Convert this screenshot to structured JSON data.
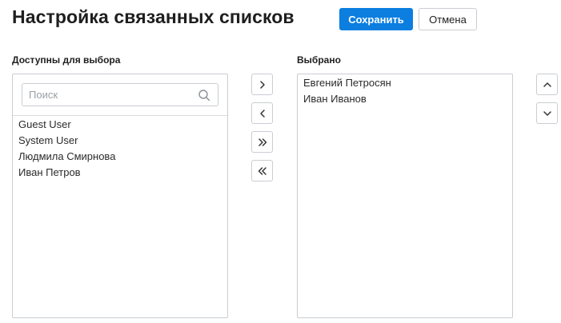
{
  "header": {
    "title": "Настройка связанных списков",
    "save_label": "Сохранить",
    "cancel_label": "Отмена"
  },
  "available": {
    "label": "Доступны для выбора",
    "search_placeholder": "Поиск",
    "search_value": "",
    "items": [
      "Guest User",
      "System User",
      "Людмила Смирнова",
      "Иван Петров"
    ]
  },
  "selected": {
    "label": "Выбрано",
    "items": [
      "Евгений Петросян",
      "Иван Иванов"
    ]
  },
  "transfer_buttons": {
    "move_right_icon": "chevron-right-icon",
    "move_left_icon": "chevron-left-icon",
    "move_all_right_icon": "double-chevron-right-icon",
    "move_all_left_icon": "double-chevron-left-icon"
  },
  "order_buttons": {
    "move_up_icon": "chevron-up-icon",
    "move_down_icon": "chevron-down-icon"
  },
  "colors": {
    "accent": "#0b7ee0",
    "border": "#c9cdd2",
    "text": "#1e1e1e"
  }
}
